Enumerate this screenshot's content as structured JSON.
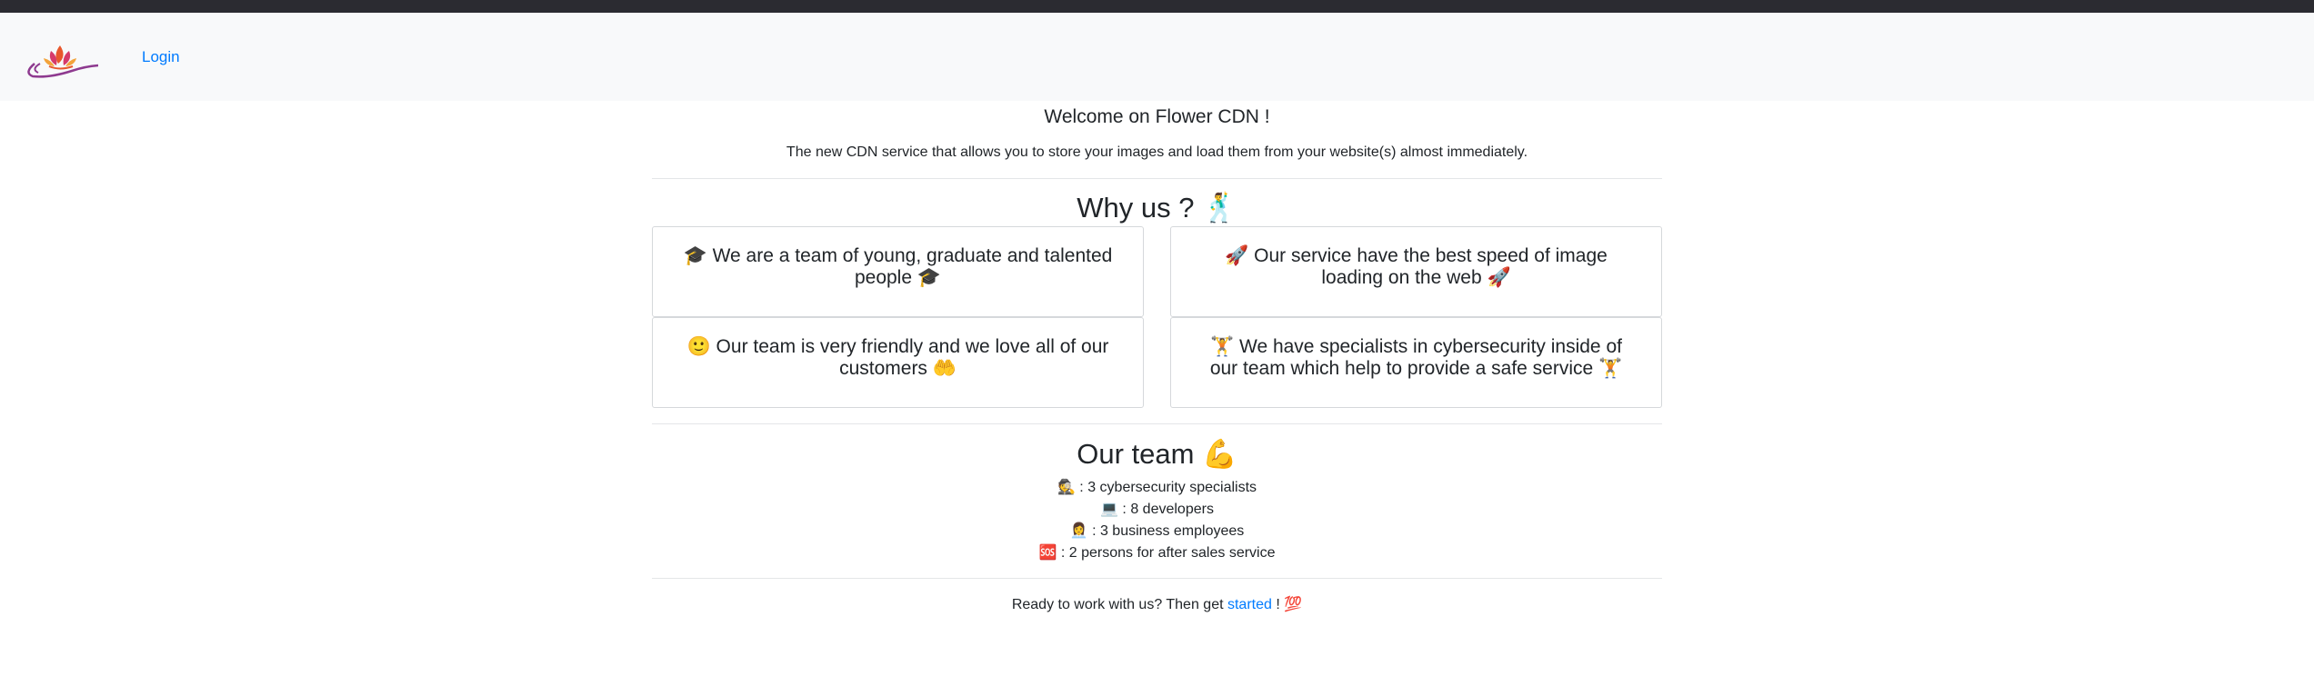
{
  "nav": {
    "login_label": "Login"
  },
  "welcome": {
    "title": "Welcome on Flower CDN !",
    "lead": "The new CDN service that allows you to store your images and load them from your website(s) almost immediately."
  },
  "why": {
    "title": "Why us ? 🕺",
    "cards": [
      "🎓 We are a team of young, graduate and talented people 🎓",
      "🚀 Our service have the best speed of image loading on the web 🚀",
      "🙂 Our team is very friendly and we love all of our customers 🤲",
      "🏋 We have specialists in cybersecurity inside of our team which help to provide a safe service 🏋"
    ]
  },
  "team": {
    "title": "Our team 💪",
    "items": [
      "🕵 : 3 cybersecurity specialists",
      "💻 : 8 developers",
      "👩‍💼 : 3 business employees",
      "🆘 : 2 persons for after sales service"
    ]
  },
  "footer": {
    "prefix": "Ready to work with us? Then get ",
    "link": "started",
    "suffix": " ! 💯"
  }
}
